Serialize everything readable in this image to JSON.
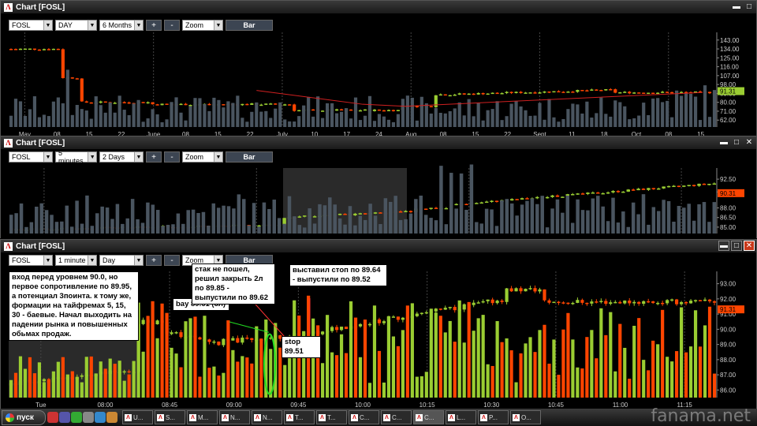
{
  "windows": [
    {
      "title": "Chart [FOSL]",
      "symbol": "FOSL",
      "interval": "DAY",
      "range": "6 Months",
      "zoom": "Zoom",
      "bar": "Bar",
      "plus": "+",
      "minus": "-"
    },
    {
      "title": "Chart [FOSL]",
      "symbol": "FOSL",
      "interval": "5 minutes",
      "range": "2 Days",
      "zoom": "Zoom",
      "bar": "Bar",
      "plus": "+",
      "minus": "-"
    },
    {
      "title": "Chart [FOSL]",
      "symbol": "FOSL",
      "interval": "1 minute",
      "range": "Day",
      "zoom": "Zoom",
      "bar": "Bar",
      "plus": "+",
      "minus": "-"
    }
  ],
  "window_buttons": {
    "minimize": "▬",
    "maximize": "□",
    "close": "✕"
  },
  "chart_data": [
    {
      "type": "line",
      "panel": "daily",
      "x_ticks": [
        "May",
        "08",
        "15",
        "22",
        "June",
        "08",
        "15",
        "22",
        "July",
        "10",
        "17",
        "24",
        "Aug",
        "08",
        "15",
        "22",
        "Sept",
        "11",
        "18",
        "Oct",
        "08",
        "15"
      ],
      "y_ticks": [
        "143.00",
        "134.00",
        "125.00",
        "116.00",
        "107.00",
        "98.00",
        "89.00",
        "80.00",
        "71.00",
        "62.00"
      ],
      "last_price": "91.31",
      "ylim": [
        55,
        146
      ]
    },
    {
      "type": "line",
      "panel": "5min",
      "y_ticks": [
        "92.50",
        "90.50",
        "88.00",
        "86.50",
        "85.00"
      ],
      "last_price": "90.31",
      "ylim": [
        84,
        93.5
      ]
    },
    {
      "type": "line",
      "panel": "1min",
      "x_ticks": [
        "Tue",
        "08:00",
        "08:45",
        "09:00",
        "09:45",
        "10:00",
        "10:15",
        "10:30",
        "10:45",
        "11:00",
        "11:15"
      ],
      "y_ticks": [
        "93.00",
        "92.00",
        "91.00",
        "90.00",
        "89.00",
        "88.00",
        "87.00",
        "86.00"
      ],
      "last_price": "91.31",
      "ylim": [
        85.5,
        93.5
      ]
    }
  ],
  "annotations": {
    "entry": "вход перед уровнем 90.0, но первое сопротивление по 89.95, а потенциал 3поинта. к тому же, формации на тайфремах 5, 15, 30 - баевые. Начал выходить на падении рынка и повышенных обьмах продаж.",
    "buy": "bay 89.61 (3л)",
    "stack": "стак не пошел, решил закрыть 2л по 89.85 - выпустили по 89.62",
    "stop_set": "выставил стоп по 89.64 - выпустили по 89.52",
    "stop": "stop 89.51"
  },
  "taskbar": {
    "start": "пуск",
    "items": [
      "U...",
      "S...",
      "M...",
      "N...",
      "N...",
      "T...",
      "T...",
      "C...",
      "C...",
      "C...",
      "L...",
      "P...",
      "O..."
    ],
    "watermark": "fanama.net"
  },
  "colors": {
    "up": "#9acd32",
    "down": "#ff4500",
    "volume": "#4a5560",
    "trend": "#d02020"
  }
}
